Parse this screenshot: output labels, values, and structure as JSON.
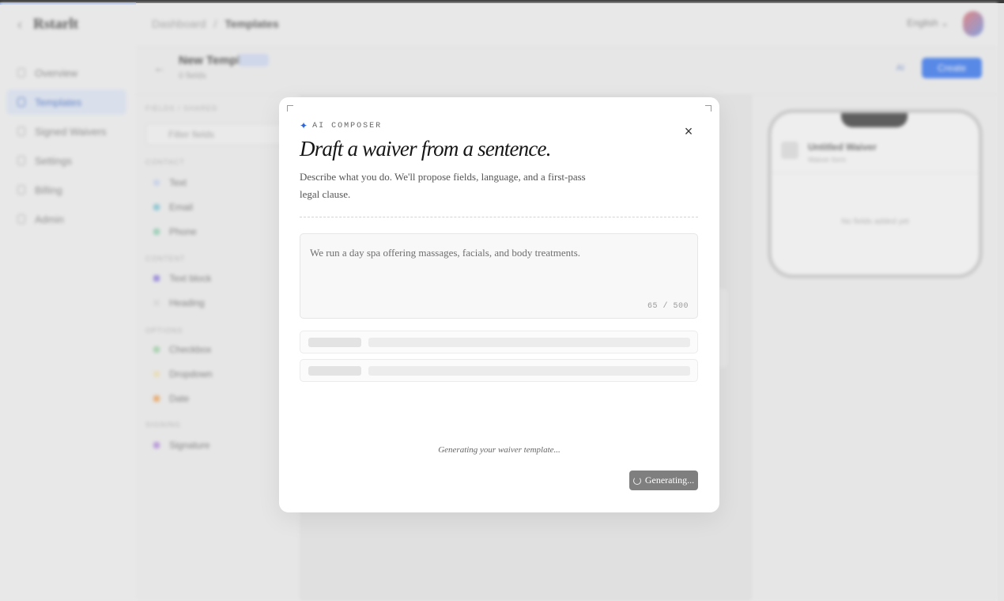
{
  "app": {
    "brand": "Rstarlt",
    "nav": [
      "Overview",
      "Templates",
      "Signed Waivers",
      "Settings",
      "Billing",
      "Admin"
    ],
    "breadcrumb": {
      "root": "Dashboard",
      "sep": "/",
      "current": "Templates"
    },
    "language": "English",
    "subheader": {
      "title": "New Template",
      "subtitle": "0 fields",
      "ai_label": "AI",
      "create_label": "Create"
    },
    "fields_panel": {
      "header": "FIELDS / SHARED",
      "filter_placeholder": "Filter fields",
      "groups": [
        {
          "label": "CONTACT",
          "items": [
            "Text",
            "Email",
            "Phone"
          ]
        },
        {
          "label": "CONTENT",
          "items": [
            "Text block",
            "Heading"
          ]
        },
        {
          "label": "OPTIONS",
          "items": [
            "Checkbox",
            "Dropdown",
            "Date"
          ]
        },
        {
          "label": "SIGNING",
          "items": [
            "Signature"
          ]
        }
      ]
    },
    "preview": {
      "title": "Untitled Waiver",
      "subtitle": "Waiver form",
      "empty": "No fields added yet"
    }
  },
  "modal": {
    "eyebrow": "AI COMPOSER",
    "title": "Draft a waiver from a sentence.",
    "description": "Describe what you do. We'll propose fields, language, and a first-pass legal clause.",
    "input_value": "We run a day spa offering massages, facials, and body treatments.",
    "char_count": "65 / 500",
    "status": "Generating your waiver template...",
    "button_label": "Generating...",
    "close_glyph": "×"
  },
  "colors": {
    "accent": "#2f66d9",
    "button_disabled": "#7f7f7f"
  }
}
